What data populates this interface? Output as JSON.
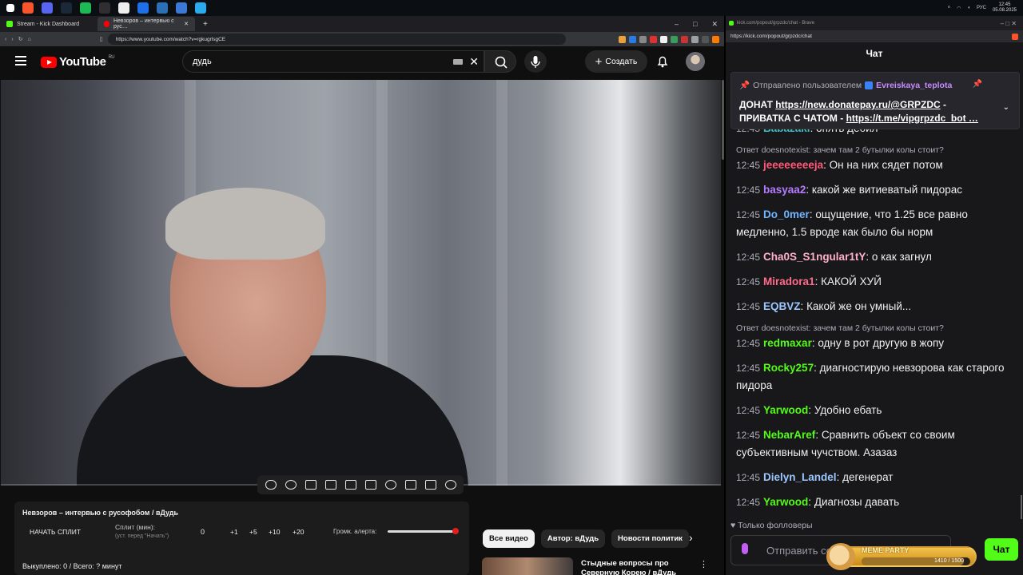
{
  "taskbar": {
    "apps": [
      {
        "name": "brave",
        "color": "#fb542b"
      },
      {
        "name": "discord",
        "color": "#5865f2"
      },
      {
        "name": "steam",
        "color": "#1b2838"
      },
      {
        "name": "spotify",
        "color": "#1db954"
      },
      {
        "name": "obs",
        "color": "#302e31"
      },
      {
        "name": "app-x",
        "color": "#eeeeee"
      },
      {
        "name": "app-b",
        "color": "#1f6feb"
      },
      {
        "name": "app-folder",
        "color": "#2b6fb6"
      },
      {
        "name": "app-tools",
        "color": "#3b78d8"
      },
      {
        "name": "telegram",
        "color": "#2aabee"
      }
    ],
    "tray": {
      "lang": "РУС",
      "time": "12:45",
      "date": "05.08.2025"
    }
  },
  "left_browser": {
    "tabs": [
      {
        "label": "Stream - Kick Dashboard",
        "favicon_color": "#53fc18"
      },
      {
        "label": "Невзоров – интервью с рус…",
        "favicon_color": "#ff0000"
      }
    ],
    "new_tab": "+",
    "url": "https://www.youtube.com/watch?v=rgkugrlsgCE",
    "extension_colors": [
      "#e9a13b",
      "#2c7be5",
      "#888888",
      "#e03131",
      "#f1f1f1",
      "#3a9d5d",
      "#cc3333",
      "#9aa0a6",
      "#555555",
      "#ff7a00"
    ]
  },
  "youtube": {
    "logo": "YouTube",
    "region": "RU",
    "search_query": "дудь",
    "create_label": "Создать",
    "colors": {
      "brand": "#ff0000"
    }
  },
  "split": {
    "title": "Невзоров – интервью с русофобом / вДудь",
    "start_label": "НАЧАТЬ СПЛИТ",
    "minutes_label": "Сплит (мин):",
    "minutes_hint": "(уст. перед \"Начать\")",
    "minutes_value": "0",
    "increments": [
      "+1",
      "+5",
      "+10",
      "+20"
    ],
    "alert_volume_label": "Громк. алерта:",
    "alert_volume": 1.0,
    "footer": "Выкуплено: 0 / Всего: ? минут"
  },
  "related": {
    "chips": [
      "Все видео",
      "Автор: вДудь",
      "Новости политик"
    ],
    "next": "›",
    "video_title": "Стыдные вопросы про Северную Корею / вДудь"
  },
  "chat": {
    "title_bar": "kick.com/popout/grpzdc/chat - Brave",
    "url": "https://kick.com/popout/grpzdc/chat",
    "header": "Чат",
    "pinned": {
      "label": "Отправлено пользователем",
      "user": "Evreiskaya_teplota",
      "text_prefix": "ДОНАТ ",
      "link1": "https://new.donatepay.ru/@GRPZDC",
      "text_mid": " - ПРИВАТКА С ЧАТОМ - ",
      "link2": "https://t.me/vipgrpzdc_bot …"
    },
    "messages": [
      {
        "time": "12:45",
        "user": "Babazaki",
        "color": "#3fc1c9",
        "text": "опять деб̈ил"
      },
      {
        "reply": "Ответ doesnotexist: зачем там 2 бутылки колы стоит?",
        "time": "12:45",
        "user": "jeeeeeeeeja",
        "color": "#ff5a7a",
        "text": "Он на них сядет потом"
      },
      {
        "time": "12:45",
        "user": "basyaa2",
        "color": "#b57cff",
        "text": "какой же витиеватый пидорас"
      },
      {
        "time": "12:45",
        "user": "Do_0mer",
        "color": "#6fb5ff",
        "text": "ощущение, что 1.25 все равно медленно, 1.5 вроде как было бы норм"
      },
      {
        "time": "12:45",
        "user": "Cha0S_S1ngular1tY",
        "color": "#ffb1c8",
        "text": "о как загнул"
      },
      {
        "time": "12:45",
        "user": "Miradora1",
        "color": "#ff6b8a",
        "text": "КАКОЙ ХУЙ"
      },
      {
        "time": "12:45",
        "user": "EQBVZ",
        "color": "#9cc6ff",
        "text": "Какой же он умный..."
      },
      {
        "reply": "Ответ doesnotexist: зачем там 2 бутылки колы стоит?",
        "time": "12:45",
        "user": "redmaxar",
        "color": "#53fc18",
        "text": "одну в рот другую в жопу"
      },
      {
        "time": "12:45",
        "user": "Rocky257",
        "color": "#53fc18",
        "text": "диагностирую невзорова как старого пидора"
      },
      {
        "time": "12:45",
        "user": "Yarwood",
        "color": "#53fc18",
        "text": "Удобно ебать"
      },
      {
        "time": "12:45",
        "user": "NebarAref",
        "color": "#53fc18",
        "text": "Сравнить объект со своим субъективным чучством. Азазаз"
      },
      {
        "time": "12:45",
        "user": "Dielyn_Landel",
        "color": "#9cc6ff",
        "text": "дегенерат"
      },
      {
        "time": "12:45",
        "user": "Yarwood",
        "color": "#53fc18",
        "text": "Диагнозы давать"
      }
    ],
    "followers_only": "Только фолловеры",
    "input_placeholder": "Отправить со",
    "send_label": "Чат",
    "meme_party": {
      "title": "MEME PARTY",
      "progress_text": "1410 / 1500",
      "progress": 0.94
    },
    "colors": {
      "accent": "#53fc18"
    }
  }
}
